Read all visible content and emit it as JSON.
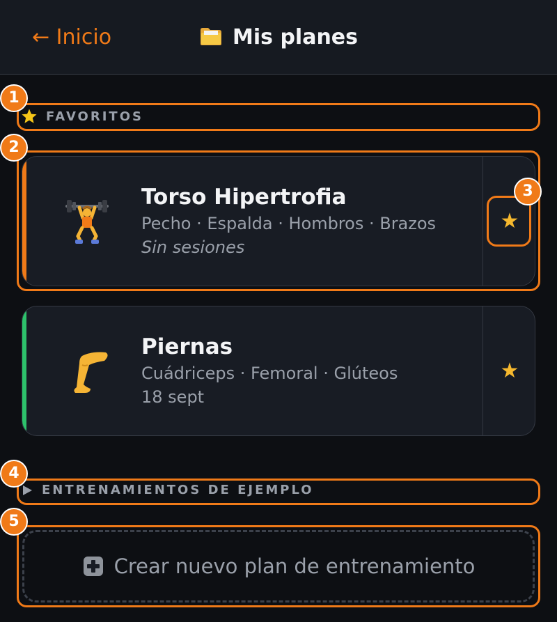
{
  "header": {
    "back_label": "← Inicio",
    "title": "Mis planes",
    "title_icon": "folder-icon"
  },
  "favorites": {
    "label": "FAVORITOS",
    "icon": "star-icon"
  },
  "plans": [
    {
      "name": "Torso Hipertrofia",
      "muscles": "Pecho · Espalda · Hombros · Brazos",
      "meta": "Sin sesiones",
      "icon": "weightlifter-icon",
      "accent": "#f07a18",
      "favorite_icon": "★"
    },
    {
      "name": "Piernas",
      "muscles": "Cuádriceps · Femoral · Glúteos",
      "meta": "18 sept",
      "icon": "leg-icon",
      "accent": "#2dc26b",
      "favorite_icon": "★"
    }
  ],
  "examples": {
    "label": "ENTRENAMIENTOS DE EJEMPLO",
    "icon": "triangle-right-icon"
  },
  "create": {
    "label": "Crear nuevo plan de entrenamiento",
    "icon": "plus-icon"
  },
  "annotations": [
    "1",
    "2",
    "3",
    "4",
    "5"
  ],
  "colors": {
    "accent": "#f07a18",
    "star": "#f5b82e",
    "background": "#0d0f13",
    "card": "#181c24"
  }
}
